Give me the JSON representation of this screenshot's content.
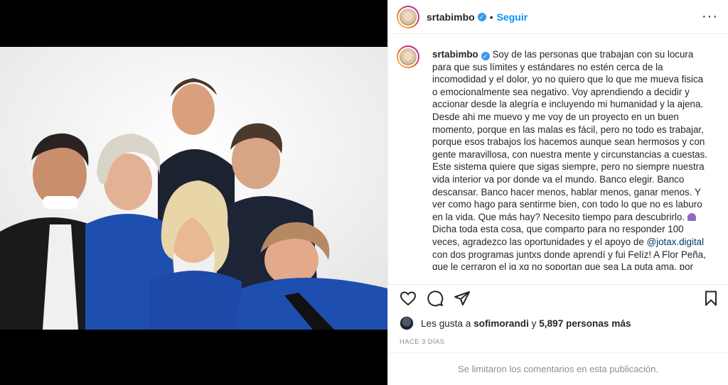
{
  "post": {
    "username": "srtabimbo",
    "verified_mark": "✓",
    "dot": "•",
    "follow_label": "Seguir",
    "more_label": "···",
    "caption_lines": [
      "Soy de las personas que trabajan con su locura",
      "para que sus límites y estándares no estén cerca de la",
      "incomodidad y el dolor, yo no quiero que lo que me mueva fisica",
      "o emocionalmente sea negativo. Voy aprendiendo a decidir y",
      "accionar desde la alegría e incluyendo mi humanidad y la ajena.",
      "Desde ahi me muevo y me voy de un proyecto en un buen",
      "momento, porque en las malas es fácil, pero no todo es trabajar,",
      "porque esos trabajos los hacemos aunque sean hermosos y con",
      "gente maravillosa, con nuestra mente y circunstancias a cuestas.",
      "Este sistema quiere que sigas siempre, pero no siempre nuestra",
      "vida interior va por donde va el mundo. Banco elegir. Banco",
      "descansar. Banco hacer menos, hablar menos, ganar menos. Y",
      "ver como hago para sentirme bien, con todo lo que no es laburo",
      "en la vida. Que más hay? Necesito tiempo para descubrirlo.",
      "Dicha toda esta cosa, que comparto para no responder 100",
      "veces, agradezco las oportunidades y el apoyo de",
      "con dos programas juntxs donde aprendí y fui Felíz! A Flor Peña,",
      "que le cerraron el ig xq no soportan que sea La puta ama, por"
    ],
    "mention": "@jotax.digital",
    "likes_prefix": "Les gusta a",
    "likes_user": "sofimorandi",
    "likes_middle": "y",
    "likes_count": "5,897 personas más",
    "timestamp": "HACE 3 DÍAS",
    "comments_notice": "Se limitaron los comentarios en esta publicación."
  },
  "icons": {
    "like": "heart-icon",
    "comment": "comment-icon",
    "share": "share-icon",
    "save": "bookmark-icon"
  },
  "colors": {
    "follow_blue": "#0095f6",
    "verified_blue": "#3897f0",
    "mention": "#00376b",
    "muted": "#8e8e8e"
  }
}
